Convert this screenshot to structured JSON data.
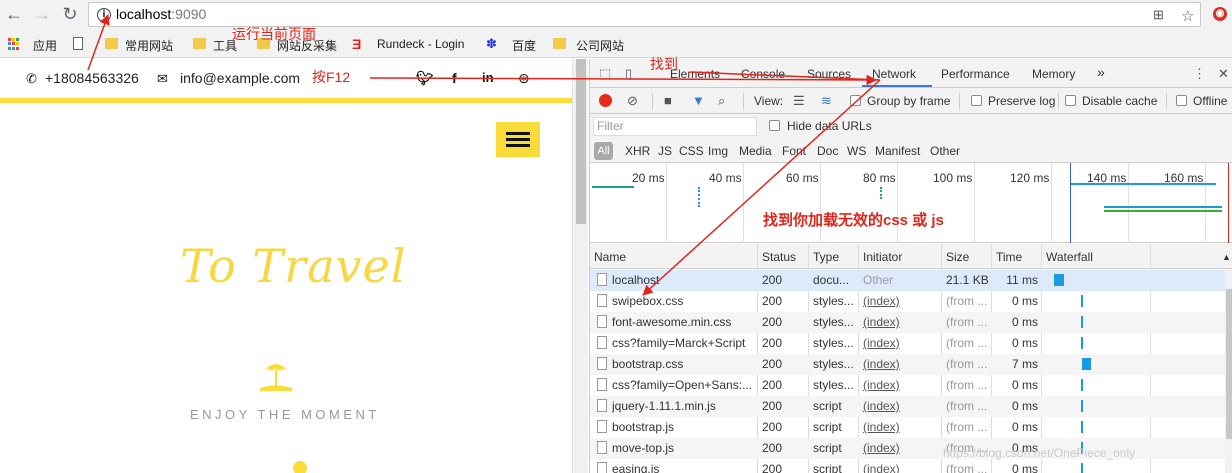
{
  "browser": {
    "url_host": "localhost",
    "url_port": ":9090",
    "bookmarks": [
      {
        "label": "应用"
      },
      {
        "label": "常用网站"
      },
      {
        "label": "工具"
      },
      {
        "label": "网站反采集"
      },
      {
        "label": "Rundeck - Login"
      },
      {
        "label": "百度"
      },
      {
        "label": "公司网站"
      }
    ]
  },
  "site": {
    "phone": "+18084563326",
    "email": "info@example.com",
    "hero_title": "To Travel",
    "tagline": "ENJOY THE MOMENT",
    "accent_color": "#f9dc3a"
  },
  "devtools": {
    "tabs": [
      "Elements",
      "Console",
      "Sources",
      "Network",
      "Performance",
      "Memory"
    ],
    "active_tab": "Network",
    "more_tabs_glyph": "»",
    "toolbar": {
      "view_label": "View:",
      "group_by_frame": "Group by frame",
      "preserve_log": "Preserve log",
      "disable_cache": "Disable cache",
      "offline": "Offline"
    },
    "filter_placeholder": "Filter",
    "hide_data_urls": "Hide data URLs",
    "type_filters": [
      "All",
      "XHR",
      "JS",
      "CSS",
      "Img",
      "Media",
      "Font",
      "Doc",
      "WS",
      "Manifest",
      "Other"
    ],
    "timeline_ticks": [
      "20 ms",
      "40 ms",
      "60 ms",
      "80 ms",
      "100 ms",
      "120 ms",
      "140 ms",
      "160 ms"
    ],
    "columns": [
      "Name",
      "Status",
      "Type",
      "Initiator",
      "Size",
      "Time",
      "Waterfall"
    ],
    "rows": [
      {
        "name": "localhost",
        "status": "200",
        "type": "docu...",
        "initiator": "Other",
        "size": "21.1 KB",
        "time": "11 ms"
      },
      {
        "name": "swipebox.css",
        "status": "200",
        "type": "styles...",
        "initiator": "(index)",
        "size": "(from ...",
        "time": "0 ms"
      },
      {
        "name": "font-awesome.min.css",
        "status": "200",
        "type": "styles...",
        "initiator": "(index)",
        "size": "(from ...",
        "time": "0 ms"
      },
      {
        "name": "css?family=Marck+Script",
        "status": "200",
        "type": "styles...",
        "initiator": "(index)",
        "size": "(from ...",
        "time": "0 ms"
      },
      {
        "name": "bootstrap.css",
        "status": "200",
        "type": "styles...",
        "initiator": "(index)",
        "size": "(from ...",
        "time": "7 ms"
      },
      {
        "name": "css?family=Open+Sans:...",
        "status": "200",
        "type": "styles...",
        "initiator": "(index)",
        "size": "(from ...",
        "time": "0 ms"
      },
      {
        "name": "jquery-1.11.1.min.js",
        "status": "200",
        "type": "script",
        "initiator": "(index)",
        "size": "(from ...",
        "time": "0 ms"
      },
      {
        "name": "bootstrap.js",
        "status": "200",
        "type": "script",
        "initiator": "(index)",
        "size": "(from ...",
        "time": "0 ms"
      },
      {
        "name": "move-top.js",
        "status": "200",
        "type": "script",
        "initiator": "(index)",
        "size": "(from ...",
        "time": "0 ms"
      },
      {
        "name": "easing.js",
        "status": "200",
        "type": "script",
        "initiator": "(index)",
        "size": "(from ...",
        "time": "0 ms"
      }
    ]
  },
  "annotations": {
    "run_page": "运行当前页面",
    "press_f12": "按F12",
    "find": "找到",
    "find_invalid": "找到你加载无效的css 或 js"
  },
  "watermark": "https://blog.csdn.net/OnePiece_only"
}
